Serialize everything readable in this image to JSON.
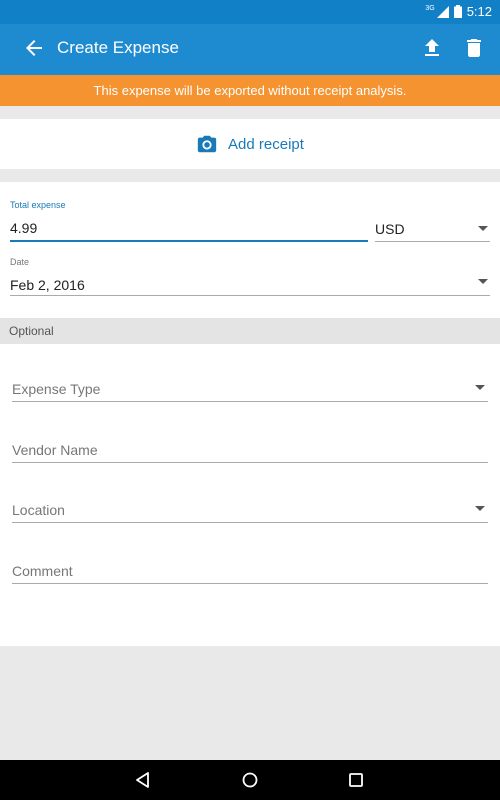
{
  "status_bar": {
    "network": "3G",
    "time": "5:12"
  },
  "app_bar": {
    "title": "Create Expense",
    "back_icon": "arrow-back-icon",
    "upload_icon": "upload-icon",
    "delete_icon": "trash-icon"
  },
  "banner": {
    "text": "This expense will be exported without receipt analysis."
  },
  "receipt": {
    "icon": "camera-icon",
    "label": "Add receipt"
  },
  "form": {
    "total_label": "Total expense",
    "total_value": "4.99",
    "currency_value": "USD",
    "date_label": "Date",
    "date_value": "Feb 2, 2016"
  },
  "optional": {
    "header": "Optional",
    "expense_type_placeholder": "Expense Type",
    "vendor_placeholder": "Vendor Name",
    "location_placeholder": "Location",
    "comment_placeholder": "Comment"
  },
  "colors": {
    "app_bar": "#1e8bd1",
    "status_bar": "#1180c6",
    "banner": "#f59331",
    "accent": "#1a7ab8"
  }
}
